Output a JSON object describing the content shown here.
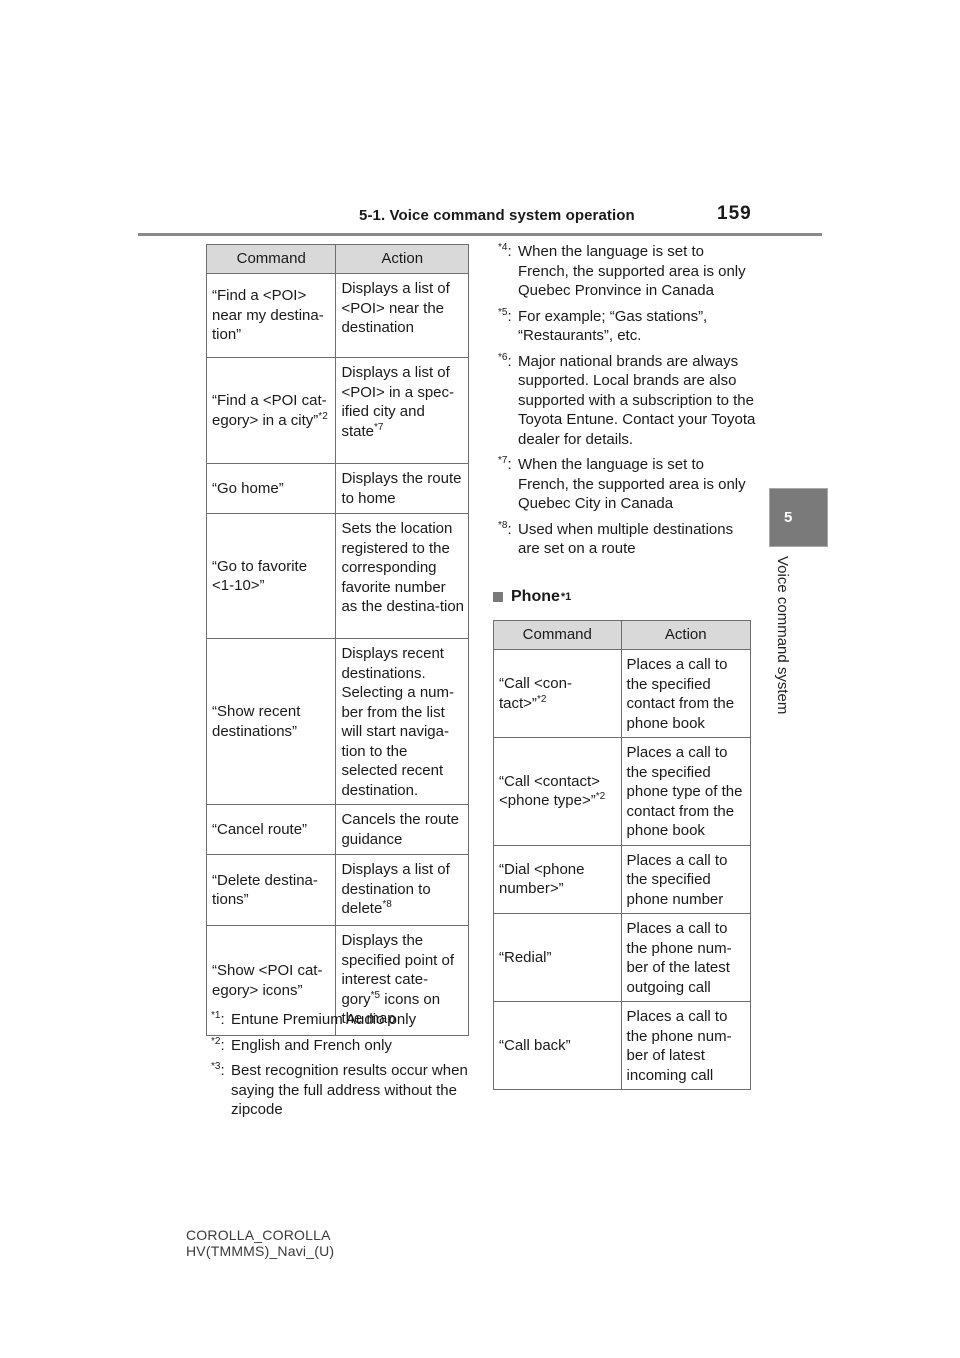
{
  "header": {
    "section_title": "5-1. Voice command system operation",
    "page_number": "159"
  },
  "chapter_tab": {
    "number": "5",
    "label": "Voice command system"
  },
  "nav_table": {
    "headers": [
      "Command",
      "Action"
    ],
    "rows": [
      {
        "command": "“Find a <POI> near my destina-tion”",
        "command_sup": "",
        "action": "Displays a list of <POI> near the destination",
        "action_sup": ""
      },
      {
        "command": "“Find a <POI cat-egory> in a city”",
        "command_sup": "*2",
        "action": "Displays a list of <POI> in a spec-ified city and state",
        "action_sup": "*7"
      },
      {
        "command": "“Go home”",
        "command_sup": "",
        "action": "Displays the route to home",
        "action_sup": ""
      },
      {
        "command": "“Go to favorite <1-10>”",
        "command_sup": "",
        "action": "Sets the location registered to the corresponding favorite number as the destina-tion",
        "action_sup": ""
      },
      {
        "command": "“Show recent destinations”",
        "command_sup": "",
        "action": "Displays recent destinations. Selecting a num-ber from the list will start naviga-tion to the selected recent destination.",
        "action_sup": ""
      },
      {
        "command": "“Cancel route”",
        "command_sup": "",
        "action": "Cancels the route guidance",
        "action_sup": ""
      },
      {
        "command": "“Delete destina-tions”",
        "command_sup": "",
        "action": "Displays a list of destination to delete",
        "action_sup": "*8"
      },
      {
        "command": "“Show <POI cat-egory> icons”",
        "command_sup": "",
        "action_pre": "Displays the specified point of interest cate-gory",
        "action_sup": "*5",
        "action_post": " icons on the map"
      }
    ]
  },
  "left_notes": [
    {
      "mark": "*1",
      "text": "Entune Premium Audio only"
    },
    {
      "mark": "*2",
      "text": "English and French only"
    },
    {
      "mark": "*3",
      "text": "Best recognition results occur when saying the full address without the zipcode"
    }
  ],
  "right_notes": [
    {
      "mark": "*4",
      "text": "When the language is set to French, the supported area is only Quebec Pronvince in Canada"
    },
    {
      "mark": "*5",
      "text": "For example; “Gas stations”, “Restaurants”, etc."
    },
    {
      "mark": "*6",
      "text": "Major national brands are always supported. Local brands are also supported with a subscription to the Toyota Entune. Contact your Toyota dealer for details."
    },
    {
      "mark": "*7",
      "text": "When the language is set to French, the supported area is only Quebec City in Canada"
    },
    {
      "mark": "*8",
      "text": "Used when multiple destinations are set on a route"
    }
  ],
  "phone_section": {
    "heading": "Phone",
    "heading_sup": "*1"
  },
  "phone_table": {
    "headers": [
      "Command",
      "Action"
    ],
    "rows": [
      {
        "command": "“Call <con-tact>”",
        "command_sup": "*2",
        "action": "Places a call to the specified contact from the phone book"
      },
      {
        "command": "“Call <contact> <phone type>”",
        "command_sup": "*2",
        "action": "Places a call to the specified phone type of the contact from the phone book"
      },
      {
        "command": "“Dial <phone number>”",
        "command_sup": "",
        "action": "Places a call to the specified phone number"
      },
      {
        "command": "“Redial”",
        "command_sup": "",
        "action": "Places a call to the phone num-ber of the latest outgoing call"
      },
      {
        "command": "“Call back”",
        "command_sup": "",
        "action": "Places a call to the phone num-ber of latest incoming call"
      }
    ]
  },
  "footer": {
    "line1": "COROLLA_COROLLA",
    "line2": "HV(TMMMS)_Navi_(U)"
  }
}
